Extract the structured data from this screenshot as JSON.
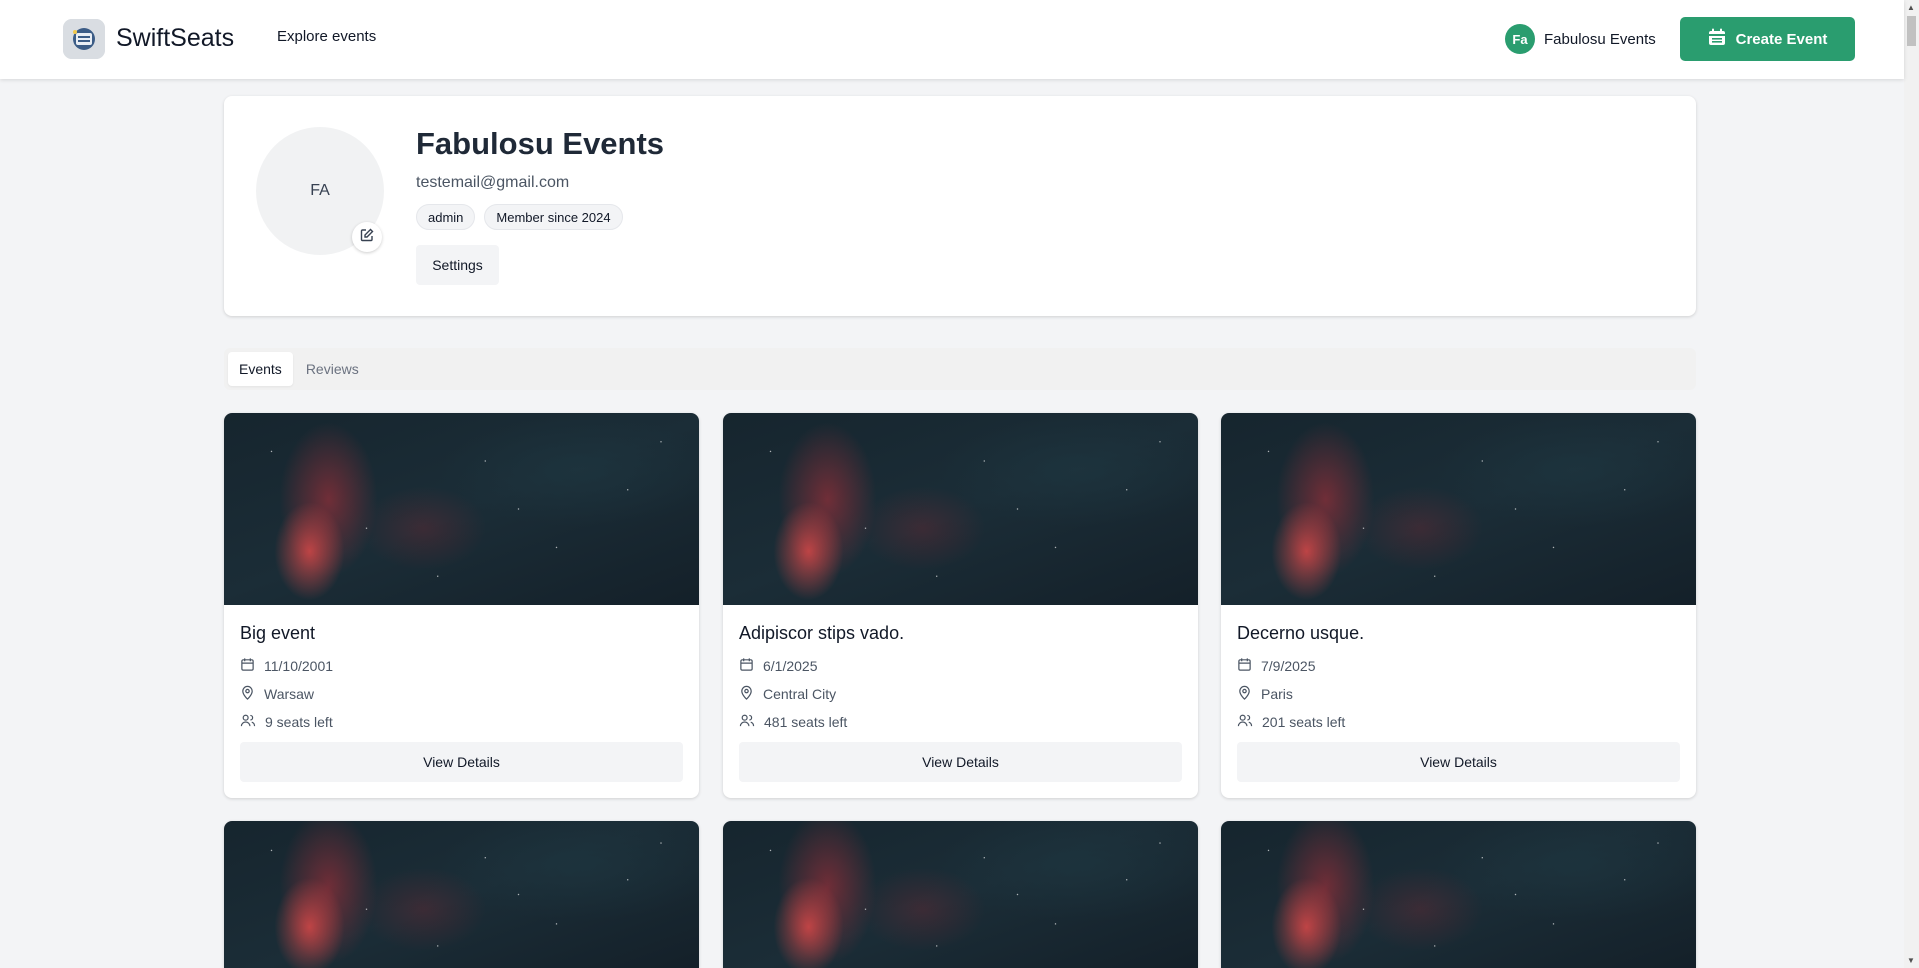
{
  "header": {
    "brand": "SwiftSeats",
    "nav_explore": "Explore events",
    "user_initials": "Fa",
    "user_name": "Fabulosu Events",
    "create_event": "Create Event",
    "accent_color": "#2a9d6f"
  },
  "profile": {
    "avatar_initials": "FA",
    "name": "Fabulosu Events",
    "email": "testemail@gmail.com",
    "badges": [
      "admin",
      "Member since 2024"
    ],
    "settings_label": "Settings",
    "edit_icon": "edit-icon"
  },
  "tabs": [
    {
      "label": "Events",
      "active": true
    },
    {
      "label": "Reviews",
      "active": false
    }
  ],
  "events": [
    {
      "title": "Big event",
      "date": "11/10/2001",
      "location": "Warsaw",
      "seats": "9 seats left",
      "button": "View Details"
    },
    {
      "title": "Adipiscor stips vado.",
      "date": "6/1/2025",
      "location": "Central City",
      "seats": "481 seats left",
      "button": "View Details"
    },
    {
      "title": "Decerno usque.",
      "date": "7/9/2025",
      "location": "Paris",
      "seats": "201 seats left",
      "button": "View Details"
    }
  ]
}
